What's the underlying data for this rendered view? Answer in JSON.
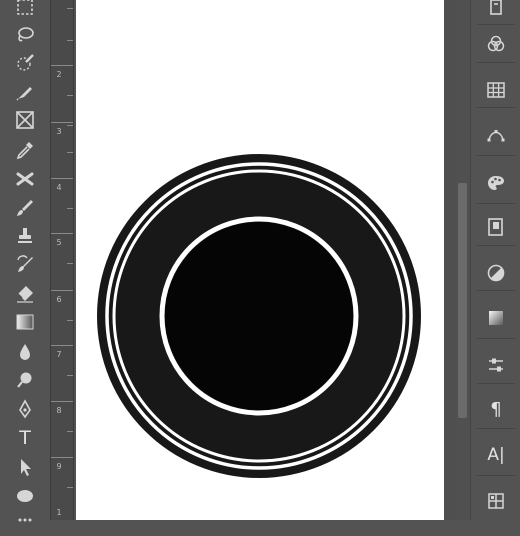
{
  "ruler": {
    "labels": [
      "1",
      "2",
      "3",
      "4",
      "5",
      "6",
      "7",
      "8",
      "9"
    ]
  },
  "tools": [
    {
      "name": "rect-marquee-tool-icon"
    },
    {
      "name": "lasso-tool-icon"
    },
    {
      "name": "quick-selection-tool-icon"
    },
    {
      "name": "pen-path-tool-icon"
    },
    {
      "name": "frame-tool-icon"
    },
    {
      "name": "eyedropper-tool-icon"
    },
    {
      "name": "healing-brush-tool-icon"
    },
    {
      "name": "brush-tool-icon"
    },
    {
      "name": "clone-stamp-tool-icon"
    },
    {
      "name": "history-brush-tool-icon"
    },
    {
      "name": "eraser-tool-icon"
    },
    {
      "name": "gradient-tool-icon"
    },
    {
      "name": "blur-tool-icon"
    },
    {
      "name": "dodge-tool-icon"
    },
    {
      "name": "pen-tool-icon"
    },
    {
      "name": "type-tool-icon"
    },
    {
      "name": "path-selection-tool-icon"
    },
    {
      "name": "ellipse-tool-icon"
    }
  ],
  "type_tool_glyph": "T",
  "panel_buttons": [
    {
      "name": "properties-icon"
    },
    {
      "name": "channels-icon"
    },
    {
      "name": "swatches-icon"
    },
    {
      "name": "paths-icon"
    },
    {
      "name": "color-icon"
    },
    {
      "name": "libraries-icon"
    },
    {
      "name": "adjustments-icon"
    },
    {
      "name": "gradients-icon"
    },
    {
      "name": "layer-comps-icon"
    },
    {
      "name": "paragraph-icon"
    },
    {
      "name": "character-icon"
    },
    {
      "name": "glyphs-icon"
    }
  ],
  "paragraph_glyph": "¶",
  "character_glyph": "A|",
  "canvas": {
    "background": "#ffffff",
    "shape_dark": "#181818",
    "shape_center": "#050505",
    "shape_ring": "#ffffff"
  }
}
